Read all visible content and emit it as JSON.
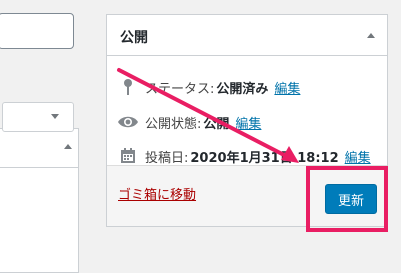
{
  "publish_box": {
    "title": "公開",
    "status": {
      "label": "ステータス:",
      "value": "公開済み",
      "edit": "編集"
    },
    "visibility": {
      "label": "公開状態:",
      "value": "公開",
      "edit": "編集"
    },
    "date": {
      "label": "投稿日:",
      "value": "2020年1月31日 18:12",
      "edit": "編集"
    },
    "trash_label": "ゴミ箱に移動",
    "update_label": "更新"
  },
  "colors": {
    "primary_button": "#007cba",
    "link": "#0073aa",
    "trash_link": "#a00000",
    "annotation": "#e91e63"
  },
  "icons": {
    "status": "pin-icon",
    "visibility": "eye-icon",
    "date": "calendar-icon"
  }
}
